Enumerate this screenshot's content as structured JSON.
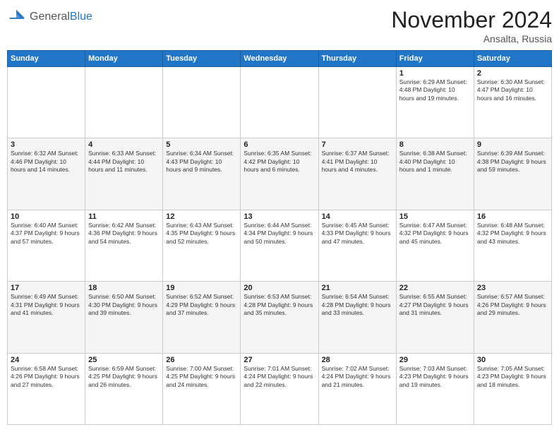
{
  "logo": {
    "general": "General",
    "blue": "Blue"
  },
  "header": {
    "month": "November 2024",
    "location": "Ansalta, Russia"
  },
  "days_of_week": [
    "Sunday",
    "Monday",
    "Tuesday",
    "Wednesday",
    "Thursday",
    "Friday",
    "Saturday"
  ],
  "weeks": [
    [
      {
        "day": "",
        "info": ""
      },
      {
        "day": "",
        "info": ""
      },
      {
        "day": "",
        "info": ""
      },
      {
        "day": "",
        "info": ""
      },
      {
        "day": "",
        "info": ""
      },
      {
        "day": "1",
        "info": "Sunrise: 6:29 AM\nSunset: 4:48 PM\nDaylight: 10 hours and 19 minutes."
      },
      {
        "day": "2",
        "info": "Sunrise: 6:30 AM\nSunset: 4:47 PM\nDaylight: 10 hours and 16 minutes."
      }
    ],
    [
      {
        "day": "3",
        "info": "Sunrise: 6:32 AM\nSunset: 4:46 PM\nDaylight: 10 hours and 14 minutes."
      },
      {
        "day": "4",
        "info": "Sunrise: 6:33 AM\nSunset: 4:44 PM\nDaylight: 10 hours and 11 minutes."
      },
      {
        "day": "5",
        "info": "Sunrise: 6:34 AM\nSunset: 4:43 PM\nDaylight: 10 hours and 9 minutes."
      },
      {
        "day": "6",
        "info": "Sunrise: 6:35 AM\nSunset: 4:42 PM\nDaylight: 10 hours and 6 minutes."
      },
      {
        "day": "7",
        "info": "Sunrise: 6:37 AM\nSunset: 4:41 PM\nDaylight: 10 hours and 4 minutes."
      },
      {
        "day": "8",
        "info": "Sunrise: 6:38 AM\nSunset: 4:40 PM\nDaylight: 10 hours and 1 minute."
      },
      {
        "day": "9",
        "info": "Sunrise: 6:39 AM\nSunset: 4:38 PM\nDaylight: 9 hours and 59 minutes."
      }
    ],
    [
      {
        "day": "10",
        "info": "Sunrise: 6:40 AM\nSunset: 4:37 PM\nDaylight: 9 hours and 57 minutes."
      },
      {
        "day": "11",
        "info": "Sunrise: 6:42 AM\nSunset: 4:36 PM\nDaylight: 9 hours and 54 minutes."
      },
      {
        "day": "12",
        "info": "Sunrise: 6:43 AM\nSunset: 4:35 PM\nDaylight: 9 hours and 52 minutes."
      },
      {
        "day": "13",
        "info": "Sunrise: 6:44 AM\nSunset: 4:34 PM\nDaylight: 9 hours and 50 minutes."
      },
      {
        "day": "14",
        "info": "Sunrise: 6:45 AM\nSunset: 4:33 PM\nDaylight: 9 hours and 47 minutes."
      },
      {
        "day": "15",
        "info": "Sunrise: 6:47 AM\nSunset: 4:32 PM\nDaylight: 9 hours and 45 minutes."
      },
      {
        "day": "16",
        "info": "Sunrise: 6:48 AM\nSunset: 4:32 PM\nDaylight: 9 hours and 43 minutes."
      }
    ],
    [
      {
        "day": "17",
        "info": "Sunrise: 6:49 AM\nSunset: 4:31 PM\nDaylight: 9 hours and 41 minutes."
      },
      {
        "day": "18",
        "info": "Sunrise: 6:50 AM\nSunset: 4:30 PM\nDaylight: 9 hours and 39 minutes."
      },
      {
        "day": "19",
        "info": "Sunrise: 6:52 AM\nSunset: 4:29 PM\nDaylight: 9 hours and 37 minutes."
      },
      {
        "day": "20",
        "info": "Sunrise: 6:53 AM\nSunset: 4:28 PM\nDaylight: 9 hours and 35 minutes."
      },
      {
        "day": "21",
        "info": "Sunrise: 6:54 AM\nSunset: 4:28 PM\nDaylight: 9 hours and 33 minutes."
      },
      {
        "day": "22",
        "info": "Sunrise: 6:55 AM\nSunset: 4:27 PM\nDaylight: 9 hours and 31 minutes."
      },
      {
        "day": "23",
        "info": "Sunrise: 6:57 AM\nSunset: 4:26 PM\nDaylight: 9 hours and 29 minutes."
      }
    ],
    [
      {
        "day": "24",
        "info": "Sunrise: 6:58 AM\nSunset: 4:26 PM\nDaylight: 9 hours and 27 minutes."
      },
      {
        "day": "25",
        "info": "Sunrise: 6:59 AM\nSunset: 4:25 PM\nDaylight: 9 hours and 26 minutes."
      },
      {
        "day": "26",
        "info": "Sunrise: 7:00 AM\nSunset: 4:25 PM\nDaylight: 9 hours and 24 minutes."
      },
      {
        "day": "27",
        "info": "Sunrise: 7:01 AM\nSunset: 4:24 PM\nDaylight: 9 hours and 22 minutes."
      },
      {
        "day": "28",
        "info": "Sunrise: 7:02 AM\nSunset: 4:24 PM\nDaylight: 9 hours and 21 minutes."
      },
      {
        "day": "29",
        "info": "Sunrise: 7:03 AM\nSunset: 4:23 PM\nDaylight: 9 hours and 19 minutes."
      },
      {
        "day": "30",
        "info": "Sunrise: 7:05 AM\nSunset: 4:23 PM\nDaylight: 9 hours and 18 minutes."
      }
    ]
  ]
}
